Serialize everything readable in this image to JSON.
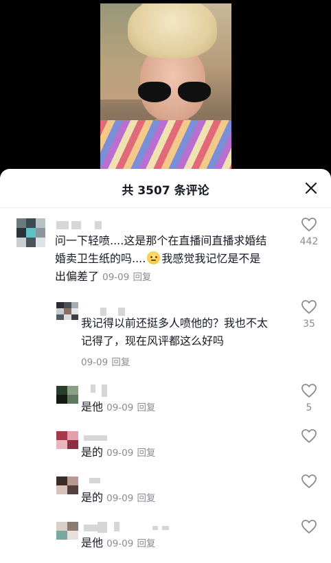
{
  "header": {
    "title": "共 3507 条评论"
  },
  "comments": [
    {
      "text_lines": [
        "问一下轻喷....这是那个在直播间直播求婚结",
        "婚卖卫生纸的吗....",
        "我感觉我记忆是不是",
        "出偏差了"
      ],
      "date": "09-09",
      "reply": "回复",
      "likes": "442"
    },
    {
      "text_lines": [
        "我记得以前还挺多人喷他的？我也不太",
        "记得了，现在风评都这么好吗"
      ],
      "date": "09-09",
      "reply": "回复",
      "likes": "35"
    },
    {
      "text": "是他",
      "date": "09-09",
      "reply": "回复",
      "likes": "5"
    },
    {
      "text": "是的",
      "date": "09-09",
      "reply": "回复",
      "likes": ""
    },
    {
      "text": "是的",
      "date": "09-09",
      "reply": "回复",
      "likes": ""
    },
    {
      "text": "是他",
      "date": "09-09",
      "reply": "回复",
      "likes": ""
    }
  ]
}
